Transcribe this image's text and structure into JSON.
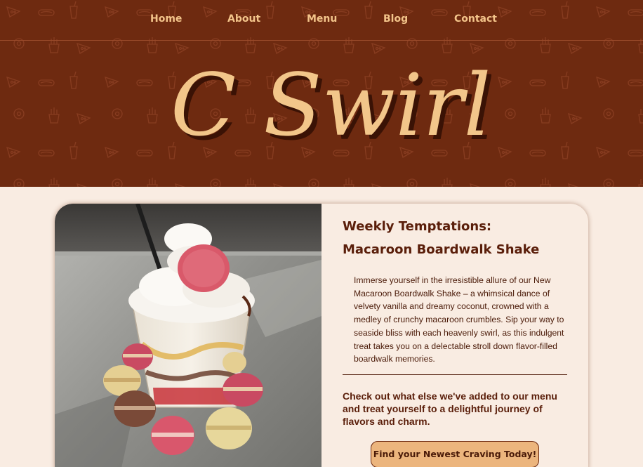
{
  "nav": {
    "items": [
      {
        "label": "Home"
      },
      {
        "label": "About"
      },
      {
        "label": "Menu"
      },
      {
        "label": "Blog"
      },
      {
        "label": "Contact"
      }
    ]
  },
  "brand": {
    "logo_text": "C Swirl",
    "logo_color": "#f2c68a",
    "logo_shadow": "#3a1205",
    "header_bg": "#6e2a10"
  },
  "feature": {
    "heading_line1": "Weekly Temptations:",
    "heading_line2": "Macaroon Boardwalk Shake",
    "description": "Immerse yourself in the irresistible allure of our New Macaroon Boardwalk Shake – a whimsical dance of velvety vanilla and dreamy coconut, crowned with a medley of crunchy macaroon crumbles. Sip your way to seaside bliss with each heavenly swirl, as this indulgent treat takes you on a delectable stroll down flavor-filled boardwalk memories.",
    "promo": "Check out what else we've added to our menu and treat yourself to a delightful journey of flavors and charm.",
    "cta_label": "Find your Newest Craving Today!"
  },
  "colors": {
    "page_bg": "#f9ece2",
    "accent": "#ecb57d",
    "text_dark": "#5a1e0a"
  },
  "icons": [
    "pizza-pattern-icon",
    "hotdog-pattern-icon",
    "drink-cup-pattern-icon",
    "donut-pattern-icon",
    "fries-pattern-icon"
  ]
}
